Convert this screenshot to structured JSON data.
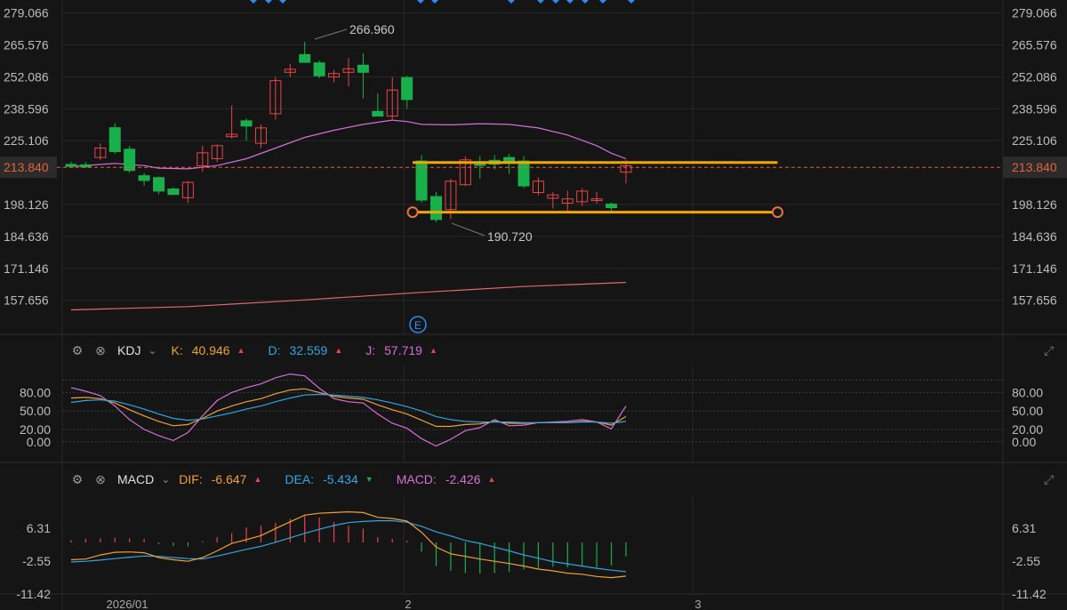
{
  "colors": {
    "bg": "#151515",
    "up": "#e8454a",
    "down": "#18b04b",
    "grid": "#262626",
    "ma_pink": "#d46fd6",
    "ma_red": "#e06a6a",
    "price_line": "#e5623a",
    "channel": "#f0a800",
    "marker": "#2f8cf2"
  },
  "main_chart": {
    "y_ticks": [
      "279.066",
      "265.576",
      "252.086",
      "238.596",
      "225.106",
      "213.840",
      "198.126",
      "184.636",
      "171.146",
      "157.656"
    ],
    "current_price": "213.840",
    "high_label": "266.960",
    "low_label": "190.720",
    "x_labels": [
      "2026/01",
      "2",
      "3"
    ],
    "event_marker": "E"
  },
  "kdj_panel": {
    "name": "KDJ",
    "k_label": "K:",
    "k_value": "40.946",
    "d_label": "D:",
    "d_value": "32.559",
    "j_label": "J:",
    "j_value": "57.719",
    "y_ticks": [
      "80.00",
      "50.00",
      "20.00",
      "0.00"
    ]
  },
  "macd_panel": {
    "name": "MACD",
    "dif_label": "DIF:",
    "dif_value": "-6.647",
    "dea_label": "DEA:",
    "dea_value": "-5.434",
    "macd_label": "MACD:",
    "macd_value": "-2.426",
    "y_ticks": [
      "6.31",
      "-2.55",
      "-11.42"
    ]
  },
  "chart_data": {
    "type": "candlestick",
    "candles": [
      {
        "o": 215.1,
        "h": 216.2,
        "l": 214.0,
        "c": 214.2
      },
      {
        "o": 214.9,
        "h": 216.0,
        "l": 213.8,
        "c": 214.0
      },
      {
        "o": 218.0,
        "h": 224.0,
        "l": 217.0,
        "c": 222.0
      },
      {
        "o": 230.6,
        "h": 232.5,
        "l": 219.5,
        "c": 220.5
      },
      {
        "o": 221.5,
        "h": 223.0,
        "l": 211.5,
        "c": 212.5
      },
      {
        "o": 210.3,
        "h": 211.5,
        "l": 206.0,
        "c": 208.3
      },
      {
        "o": 209.5,
        "h": 210.0,
        "l": 202.5,
        "c": 203.8
      },
      {
        "o": 204.7,
        "h": 205.5,
        "l": 202.0,
        "c": 202.4
      },
      {
        "o": 201.0,
        "h": 208.0,
        "l": 198.8,
        "c": 207.5
      },
      {
        "o": 214.5,
        "h": 223.0,
        "l": 212.0,
        "c": 220.0
      },
      {
        "o": 217.5,
        "h": 223.5,
        "l": 216.0,
        "c": 223.0
      },
      {
        "o": 226.8,
        "h": 240.0,
        "l": 226.0,
        "c": 227.8
      },
      {
        "o": 233.5,
        "h": 234.5,
        "l": 225.0,
        "c": 231.3
      },
      {
        "o": 224.0,
        "h": 232.0,
        "l": 222.0,
        "c": 230.5
      },
      {
        "o": 236.5,
        "h": 252.0,
        "l": 234.0,
        "c": 250.5
      },
      {
        "o": 254.0,
        "h": 257.5,
        "l": 252.0,
        "c": 255.3
      },
      {
        "o": 261.5,
        "h": 267.0,
        "l": 259.5,
        "c": 258.2
      },
      {
        "o": 258.0,
        "h": 259.0,
        "l": 251.5,
        "c": 252.5
      },
      {
        "o": 252.0,
        "h": 255.0,
        "l": 249.8,
        "c": 253.5
      },
      {
        "o": 254.0,
        "h": 260.0,
        "l": 248.0,
        "c": 255.5
      },
      {
        "o": 257.0,
        "h": 262.0,
        "l": 243.0,
        "c": 254.0
      },
      {
        "o": 237.5,
        "h": 245.0,
        "l": 235.5,
        "c": 235.5
      },
      {
        "o": 235.5,
        "h": 252.0,
        "l": 233.5,
        "c": 246.5
      },
      {
        "o": 251.8,
        "h": 252.5,
        "l": 238.5,
        "c": 242.5
      },
      {
        "o": 216.5,
        "h": 219.0,
        "l": 199.0,
        "c": 200.0
      },
      {
        "o": 201.5,
        "h": 203.5,
        "l": 190.7,
        "c": 191.8
      },
      {
        "o": 196.0,
        "h": 209.0,
        "l": 192.0,
        "c": 208.0
      },
      {
        "o": 206.5,
        "h": 218.5,
        "l": 206.0,
        "c": 217.0
      },
      {
        "o": 215.2,
        "h": 218.5,
        "l": 209.0,
        "c": 215.0
      },
      {
        "o": 216.8,
        "h": 219.0,
        "l": 213.0,
        "c": 215.2
      },
      {
        "o": 218.0,
        "h": 219.5,
        "l": 211.0,
        "c": 215.5
      },
      {
        "o": 216.5,
        "h": 218.5,
        "l": 205.0,
        "c": 206.0
      },
      {
        "o": 203.2,
        "h": 209.5,
        "l": 202.0,
        "c": 208.0
      },
      {
        "o": 200.8,
        "h": 203.5,
        "l": 196.5,
        "c": 202.2
      },
      {
        "o": 198.7,
        "h": 204.0,
        "l": 195.0,
        "c": 200.5
      },
      {
        "o": 199.3,
        "h": 205.0,
        "l": 197.5,
        "c": 203.8
      },
      {
        "o": 199.8,
        "h": 203.5,
        "l": 198.5,
        "c": 200.5
      },
      {
        "o": 198.3,
        "h": 199.0,
        "l": 195.5,
        "c": 196.8
      },
      {
        "o": 211.8,
        "h": 217.0,
        "l": 207.0,
        "c": 214.5
      }
    ],
    "ma_long": [
      {
        "i": 0,
        "v": 153.6
      },
      {
        "i": 8,
        "v": 155.0
      },
      {
        "i": 16,
        "v": 157.8
      },
      {
        "i": 24,
        "v": 161.0
      },
      {
        "i": 31,
        "v": 163.5
      },
      {
        "i": 38,
        "v": 165.2
      }
    ],
    "ma_mid": [
      {
        "i": 0,
        "v": 214.2
      },
      {
        "i": 3,
        "v": 215.5
      },
      {
        "i": 5,
        "v": 214.6
      },
      {
        "i": 6,
        "v": 213.5
      },
      {
        "i": 8,
        "v": 213.2
      },
      {
        "i": 10,
        "v": 214.6
      },
      {
        "i": 12,
        "v": 217.5
      },
      {
        "i": 14,
        "v": 222.0
      },
      {
        "i": 16,
        "v": 226.5
      },
      {
        "i": 18,
        "v": 229.5
      },
      {
        "i": 20,
        "v": 232.0
      },
      {
        "i": 22,
        "v": 233.8
      },
      {
        "i": 23,
        "v": 233.2
      },
      {
        "i": 24,
        "v": 232.0
      },
      {
        "i": 26,
        "v": 231.8
      },
      {
        "i": 28,
        "v": 232.3
      },
      {
        "i": 30,
        "v": 232.0
      },
      {
        "i": 32,
        "v": 230.5
      },
      {
        "i": 34,
        "v": 227.5
      },
      {
        "i": 36,
        "v": 223.0
      },
      {
        "i": 37,
        "v": 219.8
      },
      {
        "i": 38,
        "v": 217.5
      }
    ],
    "channel": {
      "upper": 215.9,
      "lower": 194.9,
      "start_index": 24,
      "end_index": 44
    },
    "kdj": {
      "K": [
        71,
        72,
        70,
        63,
        52,
        42,
        33,
        26,
        28,
        38,
        50,
        58,
        65,
        70,
        78,
        84,
        86,
        80,
        74,
        71,
        69,
        60,
        52,
        45,
        35,
        25,
        25,
        28,
        29,
        33,
        30,
        30,
        31,
        31,
        31,
        33,
        32,
        27,
        41
      ],
      "D": [
        64,
        67,
        68,
        66,
        60,
        53,
        45,
        38,
        35,
        37,
        42,
        47,
        53,
        58,
        65,
        71,
        76,
        77,
        76,
        74,
        72,
        68,
        63,
        57,
        50,
        41,
        36,
        33,
        32,
        32,
        32,
        31,
        31,
        31,
        31,
        32,
        32,
        30,
        33
      ],
      "J": [
        88,
        82,
        75,
        58,
        36,
        20,
        10,
        2,
        15,
        42,
        67,
        80,
        88,
        94,
        104,
        110,
        107,
        87,
        70,
        65,
        63,
        45,
        30,
        22,
        5,
        -7,
        4,
        18,
        23,
        36,
        26,
        27,
        31,
        32,
        33,
        36,
        32,
        21,
        58
      ]
    },
    "macd": {
      "DIF": [
        -2.2,
        -2.0,
        -0.9,
        -0.2,
        -0.1,
        -0.3,
        -1.6,
        -2.2,
        -2.6,
        -1.6,
        0.2,
        2.2,
        3.2,
        4.3,
        6.2,
        8.0,
        9.8,
        10.3,
        10.5,
        10.7,
        10.5,
        9.2,
        8.9,
        8.2,
        5.2,
        1.2,
        -0.6,
        -1.3,
        -2.0,
        -2.6,
        -3.2,
        -3.9,
        -4.7,
        -5.2,
        -5.8,
        -6.1,
        -6.7,
        -7.0,
        -6.6
      ],
      "DEA": [
        -2.8,
        -2.6,
        -2.3,
        -1.9,
        -1.5,
        -1.2,
        -1.3,
        -1.6,
        -1.9,
        -2.0,
        -1.2,
        -0.3,
        0.6,
        1.4,
        2.5,
        3.7,
        4.9,
        6.0,
        7.0,
        7.8,
        8.1,
        8.3,
        8.3,
        7.9,
        6.8,
        5.3,
        4.2,
        3.0,
        2.2,
        1.2,
        0.2,
        -0.9,
        -1.8,
        -2.7,
        -3.3,
        -3.9,
        -4.5,
        -5.0,
        -5.4
      ],
      "MACD": [
        0.4,
        0.6,
        0.7,
        0.8,
        0.7,
        0.6,
        -0.3,
        -0.6,
        -0.7,
        0.2,
        0.9,
        1.6,
        2.6,
        2.9,
        3.4,
        4.1,
        4.6,
        4.3,
        3.5,
        2.9,
        2.4,
        0.9,
        0.6,
        0.3,
        -1.6,
        -4.1,
        -4.9,
        -5.3,
        -5.4,
        -5.3,
        -5.1,
        -4.7,
        -4.4,
        -4.2,
        -4.3,
        -4.1,
        -4.3,
        -4.0,
        -2.4
      ]
    }
  }
}
